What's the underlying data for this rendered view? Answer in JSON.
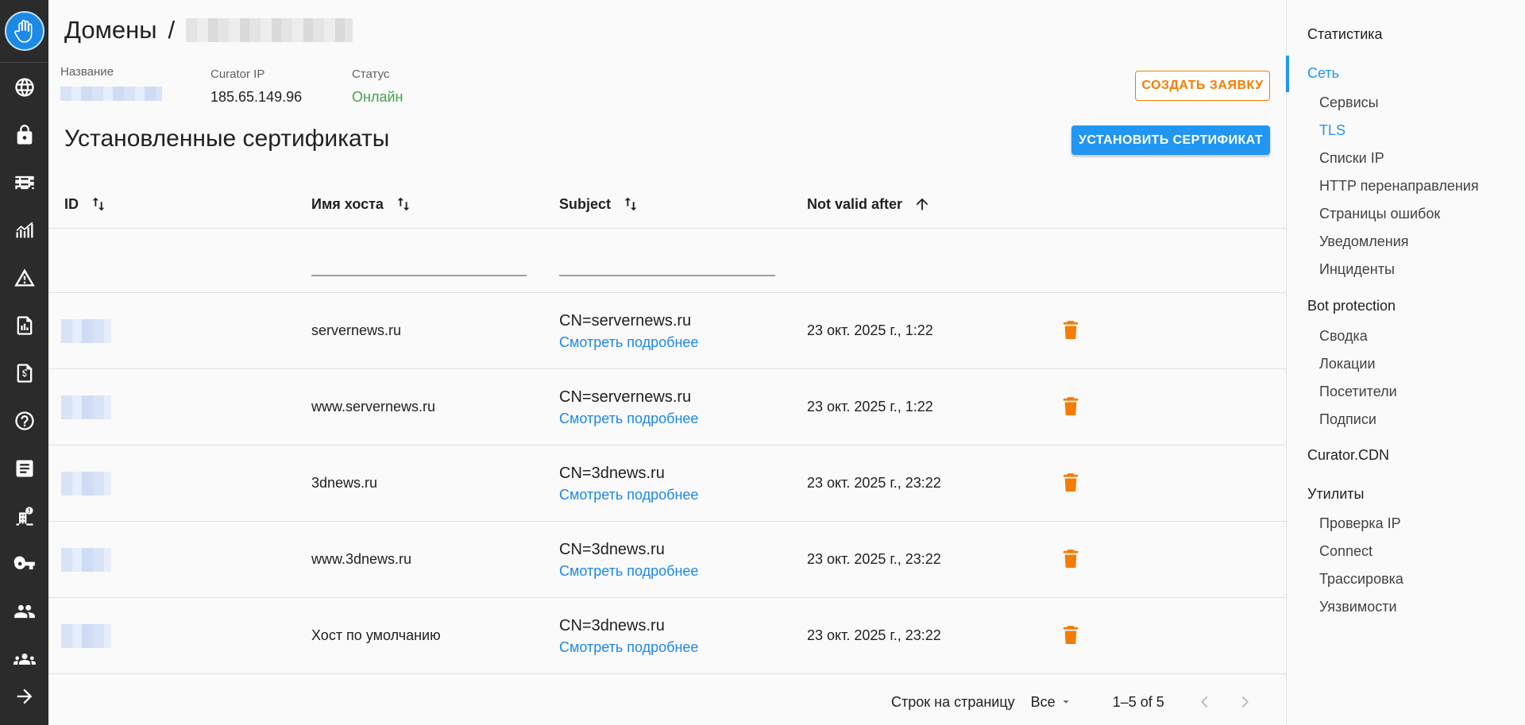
{
  "header": {
    "breadcrumb_root": "Домены",
    "breadcrumb_sep": "/",
    "meta": {
      "name_label": "Название",
      "ip_label": "Curator IP",
      "ip_value": "185.65.149.96",
      "status_label": "Статус",
      "status_value": "Онлайн"
    },
    "create_ticket_label": "СОЗДАТЬ ЗАЯВКУ"
  },
  "certs": {
    "title": "Установленные сертификаты",
    "install_label": "УСТАНОВИТЬ СЕРТИФИКАТ",
    "columns": {
      "id": "ID",
      "host": "Имя хоста",
      "subject": "Subject",
      "not_valid_after": "Not valid after"
    },
    "rows": [
      {
        "host": "servernews.ru",
        "subject": "CN=servernews.ru",
        "more": "Смотреть подробнее",
        "date": "23 окт. 2025 г., 1:22"
      },
      {
        "host": "www.servernews.ru",
        "subject": "CN=servernews.ru",
        "more": "Смотреть подробнее",
        "date": "23 окт. 2025 г., 1:22"
      },
      {
        "host": "3dnews.ru",
        "subject": "CN=3dnews.ru",
        "more": "Смотреть подробнее",
        "date": "23 окт. 2025 г., 23:22"
      },
      {
        "host": "www.3dnews.ru",
        "subject": "CN=3dnews.ru",
        "more": "Смотреть подробнее",
        "date": "23 окт. 2025 г., 23:22"
      },
      {
        "host": "Хост по умолчанию",
        "subject": "CN=3dnews.ru",
        "more": "Смотреть подробнее",
        "date": "23 окт. 2025 г., 23:22"
      }
    ],
    "footer": {
      "rows_per_page_label": "Строк на страницу",
      "rows_per_page_value": "Все",
      "range": "1–5 of 5"
    }
  },
  "right_nav": {
    "items": [
      {
        "label": "Статистика",
        "level": "group"
      },
      {
        "label": "Сеть",
        "level": "group",
        "active": true
      },
      {
        "label": "Сервисы",
        "level": "sub"
      },
      {
        "label": "TLS",
        "level": "sub",
        "active": true
      },
      {
        "label": "Списки IP",
        "level": "sub"
      },
      {
        "label": "HTTP перенаправления",
        "level": "sub"
      },
      {
        "label": "Страницы ошибок",
        "level": "sub"
      },
      {
        "label": "Уведомления",
        "level": "sub"
      },
      {
        "label": "Инциденты",
        "level": "sub"
      },
      {
        "label": "Bot protection",
        "level": "group"
      },
      {
        "label": "Сводка",
        "level": "sub"
      },
      {
        "label": "Локации",
        "level": "sub"
      },
      {
        "label": "Посетители",
        "level": "sub"
      },
      {
        "label": "Подписи",
        "level": "sub"
      },
      {
        "label": "Curator.CDN",
        "level": "group"
      },
      {
        "label": "Утилиты",
        "level": "group"
      },
      {
        "label": "Проверка IP",
        "level": "sub"
      },
      {
        "label": "Connect",
        "level": "sub"
      },
      {
        "label": "Трассировка",
        "level": "sub"
      },
      {
        "label": "Уязвимости",
        "level": "sub"
      }
    ]
  },
  "left_rail_icons": [
    "globe-icon",
    "lock-icon",
    "firewall-icon",
    "analytics-icon",
    "warning-icon",
    "reports-icon",
    "billing-icon",
    "help-icon",
    "article-icon",
    "building-alert-icon",
    "key-icon",
    "people-icon",
    "groups-icon",
    "expand-arrow-icon"
  ],
  "colors": {
    "accent": "#2196f3",
    "orange": "#f57c00",
    "success": "#43a047",
    "rail": "#2b2b2b"
  }
}
